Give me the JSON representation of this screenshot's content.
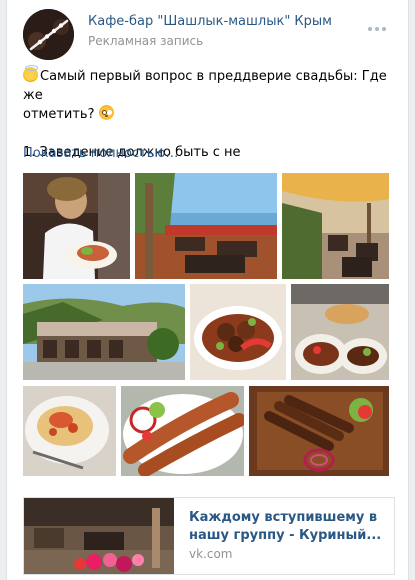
{
  "post": {
    "author_name": "Кафе-бар \"Шашлык-машлык\" Крым",
    "subline": "Рекламная запись",
    "text_line1": "Самый первый вопрос в преддверие свадьбы: Где же",
    "text_line2": "отметить?",
    "text_line3": "1. Заведение должно быть с не",
    "show_more": "Показать полностью…",
    "emoji_icons": [
      "smiling-face-with-halo",
      "flushed-face"
    ]
  },
  "photos": [
    {
      "name": "photo-waitress-serving"
    },
    {
      "name": "photo-terrace-sea-view"
    },
    {
      "name": "photo-cafe-veranda"
    },
    {
      "name": "photo-cafe-exterior"
    },
    {
      "name": "photo-kebab-plate"
    },
    {
      "name": "photo-grill-dishes"
    },
    {
      "name": "photo-baked-dish"
    },
    {
      "name": "photo-lula-kebab"
    },
    {
      "name": "photo-ribs-platter"
    }
  ],
  "link": {
    "title": "Каждому вступившему в нашу группу - Куриный...",
    "domain": "vk.com"
  },
  "colors": {
    "link": "#2a5885",
    "meta": "#939393",
    "border": "#dce1e6",
    "background": "#edeef0"
  }
}
